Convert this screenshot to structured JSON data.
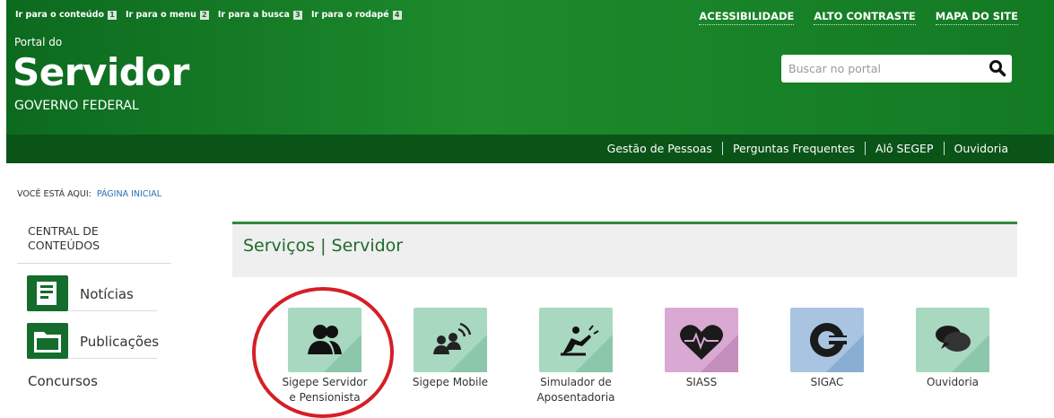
{
  "skip_links": [
    {
      "label": "Ir para o conteúdo",
      "key": "1"
    },
    {
      "label": "Ir para o menu",
      "key": "2"
    },
    {
      "label": "Ir para a busca",
      "key": "3"
    },
    {
      "label": "Ir para o rodapé",
      "key": "4"
    }
  ],
  "top_links": [
    "ACESSIBILIDADE",
    "ALTO CONTRASTE",
    "MAPA DO SITE"
  ],
  "header": {
    "portal_do": "Portal do",
    "title": "Servidor",
    "subtitle": "GOVERNO FEDERAL",
    "search_placeholder": "Buscar no portal",
    "search_icon": "search-icon"
  },
  "nav": [
    "Gestão de Pessoas",
    "Perguntas Frequentes",
    "Alô SEGEP",
    "Ouvidoria"
  ],
  "breadcrumb": {
    "prefix": "VOCÊ ESTÁ AQUI:",
    "current": "PÁGINA INICIAL"
  },
  "sidebar": {
    "heading_line1": "CENTRAL DE",
    "heading_line2": "CONTEÚDOS",
    "items": [
      {
        "label": "Notícias",
        "icon": "document-icon"
      },
      {
        "label": "Publicações",
        "icon": "folder-icon"
      }
    ],
    "extra": "Concursos"
  },
  "section_title": "Serviços | Servidor",
  "services": [
    {
      "line1": "Sigepe Servidor",
      "line2": "e Pensionista",
      "icon": "users-icon",
      "color": "#a8d9c0"
    },
    {
      "line1": "Sigepe Mobile",
      "line2": "",
      "icon": "mobile-users-icon",
      "color": "#a8d9c0"
    },
    {
      "line1": "Simulador de",
      "line2": "Aposentadoria",
      "icon": "retiree-chair-icon",
      "color": "#a8d9c0"
    },
    {
      "line1": "SIASS",
      "line2": "",
      "icon": "heartbeat-icon",
      "color": "#d9a8d3"
    },
    {
      "line1": "SIGAC",
      "line2": "",
      "icon": "sigac-icon",
      "color": "#a8c4e0"
    },
    {
      "line1": "Ouvidoria",
      "line2": "",
      "icon": "speech-bubbles-icon",
      "color": "#a8d9c0"
    }
  ],
  "colors": {
    "header_green": "#1d8a2c",
    "nav_green": "#0a5418",
    "highlight_red": "#d41f26"
  }
}
